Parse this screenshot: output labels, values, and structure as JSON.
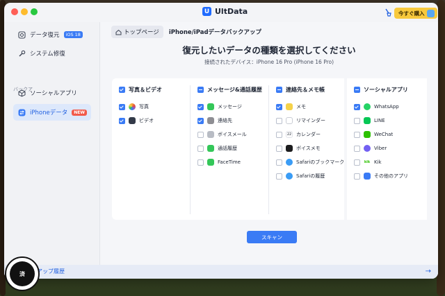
{
  "titlebar": {
    "app_name": "UltData",
    "buy_label": "今すぐ購入"
  },
  "sidebar": {
    "items": [
      {
        "label": "データ復元",
        "badge": "iOS 18",
        "icon": "restore-icon"
      },
      {
        "label": "システム修復",
        "icon": "wrench-icon"
      }
    ],
    "section_label": "バックア",
    "backup_items": [
      {
        "label": "ソーシャルアプリ",
        "icon": "cube-icon"
      },
      {
        "label": "iPhoneデータ",
        "badge": "NEW",
        "icon": "swap-icon",
        "active": true
      }
    ]
  },
  "breadcrumb": {
    "home": "トップページ",
    "current": "iPhone/iPadデータバックアップ"
  },
  "main": {
    "heading": "復元したいデータの種類を選択してください",
    "device_line": "接続されたデバイス：iPhone 16 Pro (iPhone 16 Pro)",
    "scan_label": "スキャン"
  },
  "columns": [
    {
      "header": "写真＆ビデオ",
      "state": "checked",
      "items": [
        {
          "label": "写真",
          "checked": true,
          "icon": "photos-icon",
          "color": "#f2a33a"
        },
        {
          "label": "ビデオ",
          "checked": true,
          "icon": "clapper-icon",
          "color": "#333a48"
        }
      ]
    },
    {
      "header": "メッセージ&通話履歴",
      "state": "partial",
      "items": [
        {
          "label": "メッセージ",
          "checked": true,
          "icon": "messages-icon",
          "color": "#34c759"
        },
        {
          "label": "連絡先",
          "checked": true,
          "icon": "contacts-icon",
          "color": "#8e8e93"
        },
        {
          "label": "ボイスメール",
          "checked": false,
          "icon": "voicemail-icon",
          "color": "#b8bcc4"
        },
        {
          "label": "通話履歴",
          "checked": false,
          "icon": "phone-icon",
          "color": "#34c759"
        },
        {
          "label": "FaceTime",
          "checked": false,
          "icon": "facetime-icon",
          "color": "#34c759"
        }
      ]
    },
    {
      "header": "連絡先＆メモ帳",
      "state": "partial",
      "items": [
        {
          "label": "メモ",
          "checked": true,
          "icon": "notes-icon",
          "color": "#f5d24a"
        },
        {
          "label": "リマインダー",
          "checked": false,
          "icon": "reminders-icon",
          "color": "#c9ccd3"
        },
        {
          "label": "カレンダー",
          "checked": false,
          "icon": "calendar-icon",
          "color": "#ffffff",
          "glyph": "22"
        },
        {
          "label": "ボイスメモ",
          "checked": false,
          "icon": "voice-memo-icon",
          "color": "#1c1c1e"
        },
        {
          "label": "Safariのブックマーク",
          "checked": false,
          "icon": "safari-icon",
          "color": "#3a9cf5"
        },
        {
          "label": "Safariの履歴",
          "checked": false,
          "icon": "safari-icon",
          "color": "#3a9cf5"
        }
      ]
    },
    {
      "header": "ソーシャルアプリ",
      "state": "partial",
      "items": [
        {
          "label": "WhatsApp",
          "checked": true,
          "icon": "whatsapp-icon",
          "color": "#25d366"
        },
        {
          "label": "LINE",
          "checked": false,
          "icon": "line-icon",
          "color": "#06c755"
        },
        {
          "label": "WeChat",
          "checked": false,
          "icon": "wechat-icon",
          "color": "#2dc100"
        },
        {
          "label": "Viber",
          "checked": false,
          "icon": "viber-icon",
          "color": "#7360f2"
        },
        {
          "label": "Kik",
          "checked": false,
          "icon": "kik-icon",
          "color": "#ffffff",
          "glyph": "kik"
        },
        {
          "label": "その他のアプリ",
          "checked": false,
          "icon": "apps-grid-icon",
          "color": "#3a7bf5"
        }
      ]
    }
  ],
  "footer": {
    "link": "バックアップ履歴",
    "arrow": "→"
  },
  "watermark": {
    "text": "済"
  }
}
